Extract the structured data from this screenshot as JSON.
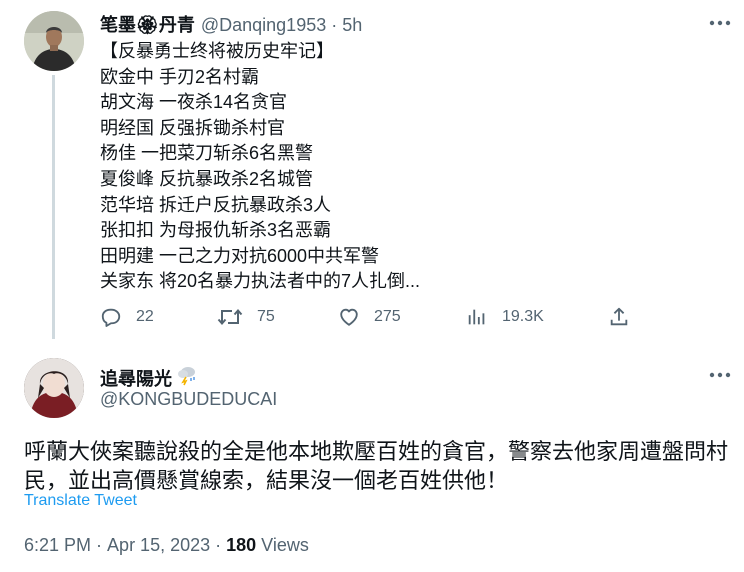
{
  "parent_tweet": {
    "display_name": "笔墨🏵丹青",
    "handle": "@Danqing1953",
    "separator": "·",
    "time": "5h",
    "lines": [
      "【反暴勇士终将被历史牢记】",
      "欧金中 手刃2名村霸",
      "胡文海 一夜杀14名贪官",
      "明经国 反强拆锄杀村官",
      "杨佳 一把菜刀斩杀6名黑警",
      "夏俊峰 反抗暴政杀2名城管",
      "范华培 拆迁户反抗暴政杀3人",
      "张扣扣 为母报仇斩杀3名恶霸",
      "田明建 一己之力对抗6000中共军警",
      "关家东 将20名暴力执法者中的7人扎倒..."
    ],
    "stats": {
      "replies": "22",
      "retweets": "75",
      "likes": "275",
      "views": "19.3K"
    }
  },
  "reply_tweet": {
    "display_name": "追尋陽光",
    "handle": "@KONGBUDEDUCAI",
    "text_lines": [
      "呼蘭大俠案聽說殺的全是他本地欺壓百姓的貪官，警察去他家周遭盤問村",
      "民，並出高價懸賞線索，結果沒一個老百姓供他！"
    ],
    "translate_label": "Translate Tweet",
    "time": "6:21 PM",
    "separator": "·",
    "date": "Apr 15, 2023",
    "views_count": "180",
    "views_label": "Views"
  },
  "icons": {
    "parent_avatar": "man-portrait-avatar",
    "reply_avatar": "anime-character-avatar",
    "more": "more-icon",
    "reply": "reply-icon",
    "retweet": "retweet-icon",
    "like": "heart-icon",
    "views": "bar-chart-icon",
    "share": "share-icon",
    "weather_emoji": "cloud-lightning-icon"
  },
  "colors": {
    "primary_text": "#0f1419",
    "secondary_text": "#536471",
    "link": "#1d9bf0",
    "thread_line": "#cfd9de"
  }
}
